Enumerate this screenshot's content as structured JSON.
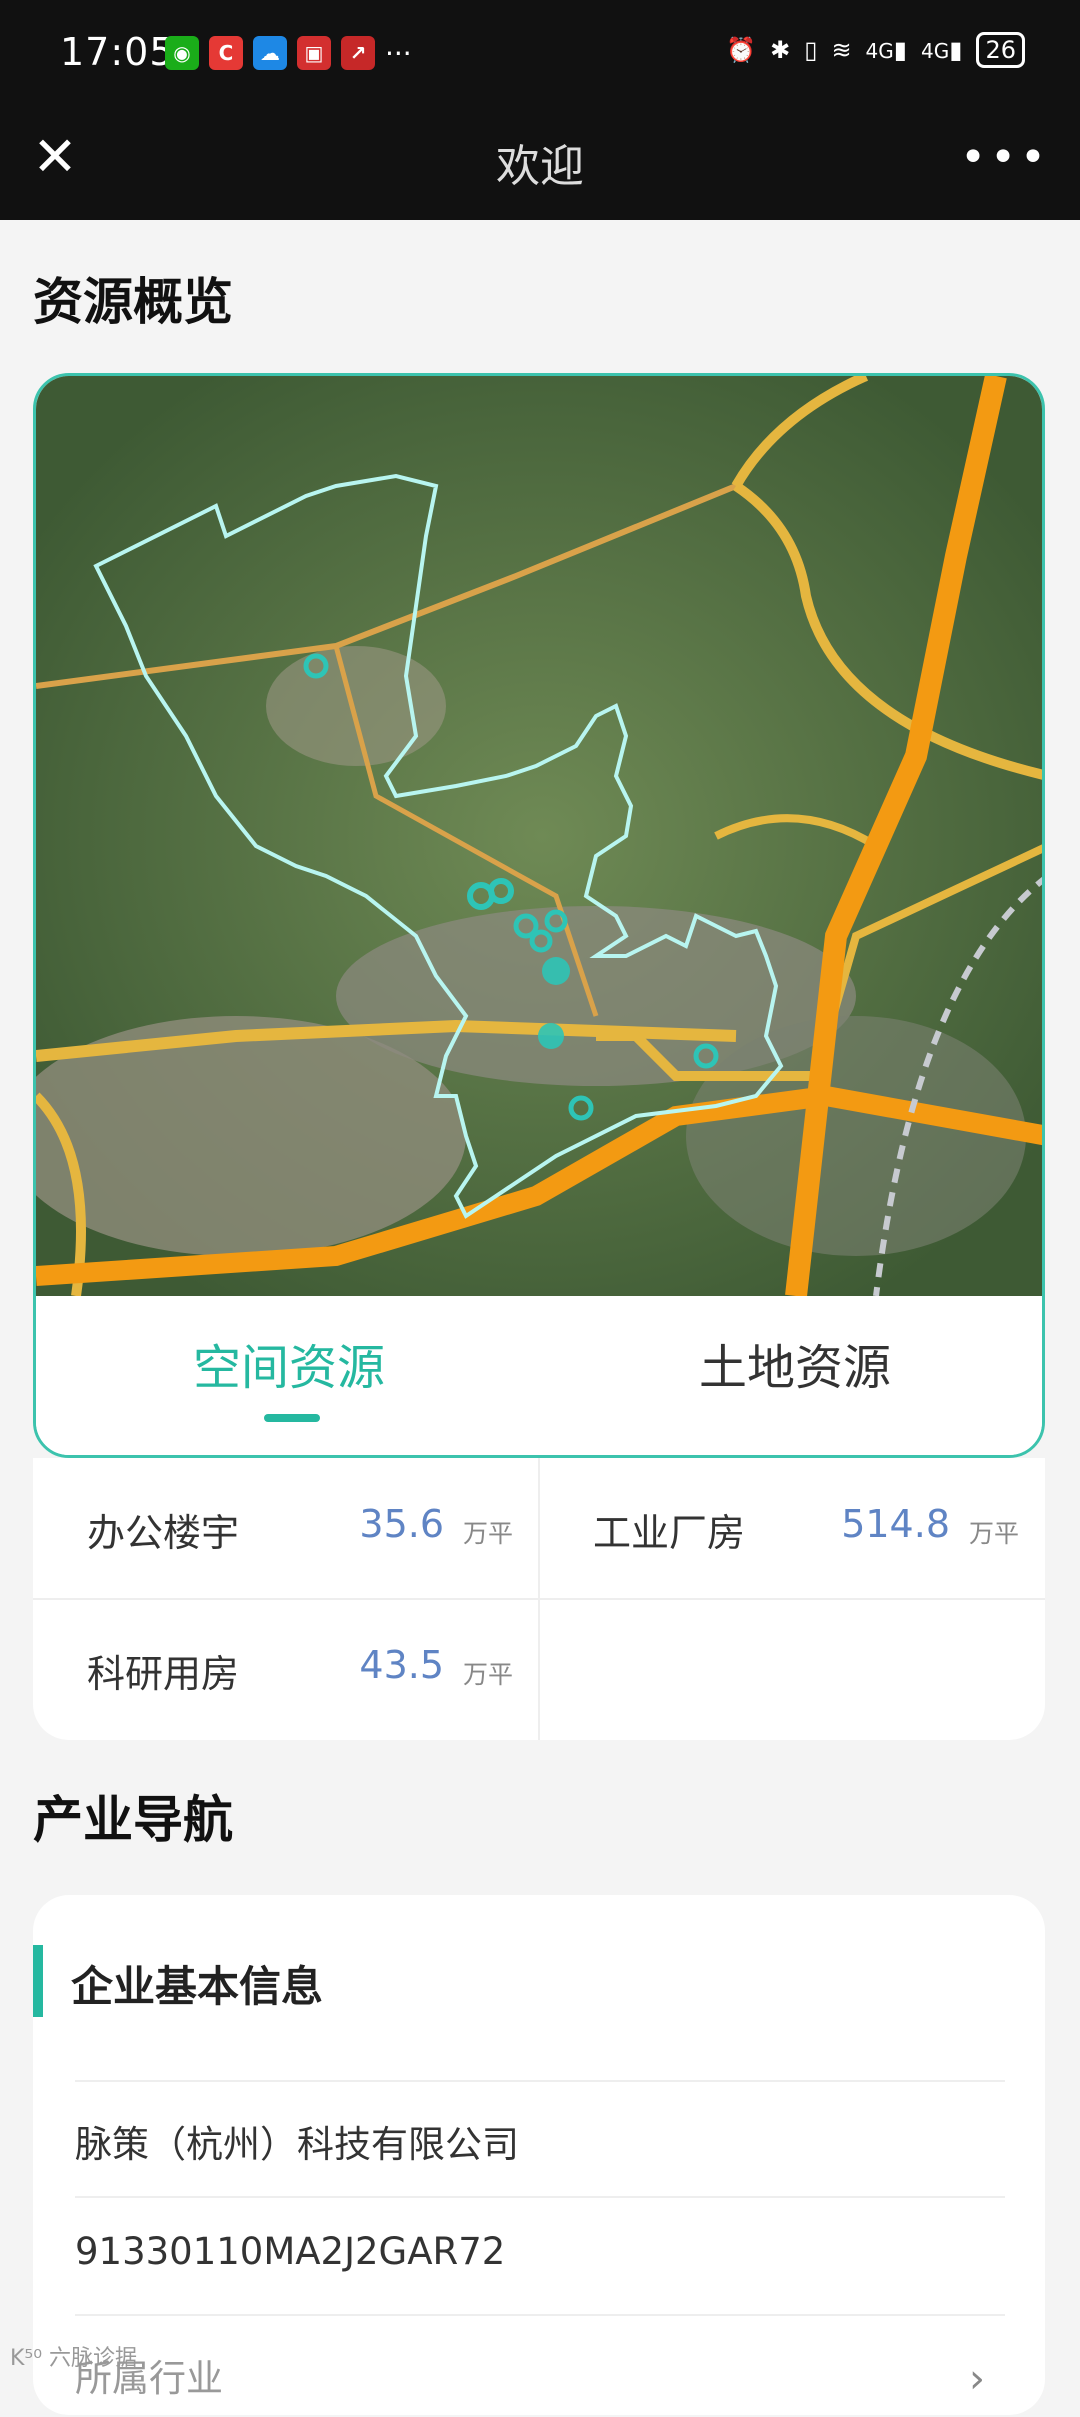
{
  "status_bar": {
    "time": "17:05",
    "more": "···",
    "signal1": "4G",
    "signal2": "4G",
    "battery": "26"
  },
  "title_bar": {
    "close_glyph": "✕",
    "title": "欢迎",
    "more_glyph": "•••"
  },
  "resource": {
    "section_title": "资源概览",
    "tabs": [
      {
        "label": "空间资源",
        "active": true
      },
      {
        "label": "土地资源",
        "active": false
      }
    ],
    "stats": [
      {
        "label": "办公楼宇",
        "value": "35.6",
        "unit": "万平"
      },
      {
        "label": "工业厂房",
        "value": "514.8",
        "unit": "万平"
      },
      {
        "label": "科研用房",
        "value": "43.5",
        "unit": "万平"
      }
    ]
  },
  "industry": {
    "section_title": "产业导航",
    "card_title": "企业基本信息",
    "company_name": "脉策（杭州）科技有限公司",
    "credit_code": "91330110MA2J2GAR72",
    "partial_row": "所属行业"
  },
  "watermark": "K⁵⁰ 六脉诊据",
  "colors": {
    "accent": "#25b8a0",
    "value_blue": "#5f84c4",
    "topbar": "#111111"
  }
}
